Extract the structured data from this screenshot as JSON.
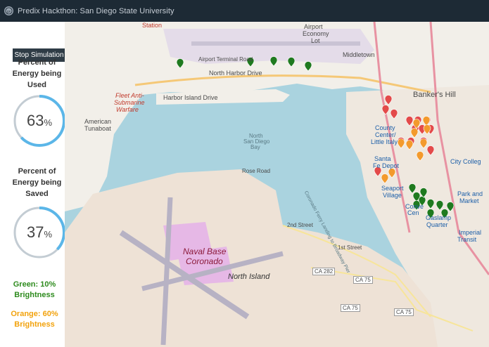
{
  "header": {
    "title": "Predix Hackthon: San Diego State University",
    "logo_icon": "ge-logo-icon"
  },
  "sidebar": {
    "stop_button": "Stop Simulation",
    "used": {
      "label_line1": "Percent of",
      "label_line2": "Energy being",
      "label_line3": "Used",
      "value": 63,
      "value_text": "63",
      "unit": "%"
    },
    "saved": {
      "label_line1": "Percent of",
      "label_line2": "Energy being",
      "label_line3": "Saved",
      "value": 37,
      "value_text": "37",
      "unit": "%"
    },
    "legend": {
      "green_line1": "Green: 10%",
      "green_line2": "Brightness",
      "orange_line1": "Orange: 60%",
      "orange_line2": "Brightness"
    },
    "gauge_color": "#5bb6e8",
    "gauge_track_color": "#c3ccd3"
  },
  "colors": {
    "green_marker": "#1f7a1f",
    "orange_marker": "#f39a2d",
    "red_marker": "#e34a4a",
    "legend_green": "#2e8b1e",
    "legend_orange": "#f2a20c"
  },
  "map": {
    "labels": {
      "airport": "Airport",
      "economy": "Economy",
      "lot": "Lot",
      "middletown": "Middletown",
      "bankers_hill": "Banker's Hill",
      "north_harbor_drive": "North Harbor Drive",
      "harbor_island_drive": "Harbor Island Drive",
      "fleet_anti_submarine": "Fleet Anti-",
      "submarine": "Submarine",
      "warfare": "Warfare",
      "american_tunaboat": "American",
      "tunaboat": "Tunaboat",
      "north_san_diego_bay": "North",
      "san_diego": "San Diego",
      "bay": "Bay",
      "county_center": "County",
      "center_little_italy": "Center/",
      "little_italy": "Little Italy",
      "santa_fe_depot": "Santa",
      "fe_depot": "Fe Depot",
      "seaport_village": "Seaport",
      "village": "Village",
      "convention": "Conve",
      "center": "Cen",
      "gaslamp": "Gaslamp",
      "quarter": "Quarter",
      "city_college": "City Colleg",
      "park_and_market": "Park and",
      "market": "Market",
      "imperial": "Imperial",
      "transit": "Transit",
      "naval_base_coronado": "Naval Base",
      "coronado": "Coronado",
      "north_island": "North Island",
      "rose_road": "Rose Road",
      "second_street": "2nd Street",
      "first_street": "1st Street",
      "ca282": "CA 282",
      "ca75": "CA 75",
      "station": "Station",
      "airport_terminal": "Airport Terminal Road",
      "ferry": "Coronado Ferry Landing to Broadway Pier"
    },
    "green_marker_count": 15,
    "orange_marker_count": 10,
    "red_marker_count": 14
  }
}
